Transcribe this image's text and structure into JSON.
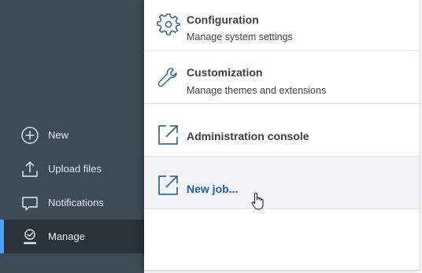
{
  "sidebar": {
    "items": [
      {
        "label": "New",
        "icon": "plus-circle-icon"
      },
      {
        "label": "Upload files",
        "icon": "upload-icon"
      },
      {
        "label": "Notifications",
        "icon": "chat-bubble-icon"
      },
      {
        "label": "Manage",
        "icon": "manage-user-icon"
      }
    ],
    "active_index": 3,
    "colors": {
      "background": "#3d4a57",
      "active_background": "#2a333c",
      "accent": "#4d9ef7"
    }
  },
  "panel": {
    "items": [
      {
        "title": "Configuration",
        "subtitle": "Manage system settings",
        "icon": "gear-icon"
      },
      {
        "title": "Customization",
        "subtitle": "Manage themes and extensions",
        "icon": "wrench-icon"
      },
      {
        "title": "Administration console",
        "icon": "external-link-icon"
      },
      {
        "title": "New job...",
        "icon": "external-link-icon"
      }
    ],
    "hovered_index": 3,
    "colors": {
      "hover_title": "#1f5fa8",
      "title": "#3b4046"
    }
  },
  "cursor": {
    "icon": "hand-pointer-icon"
  }
}
